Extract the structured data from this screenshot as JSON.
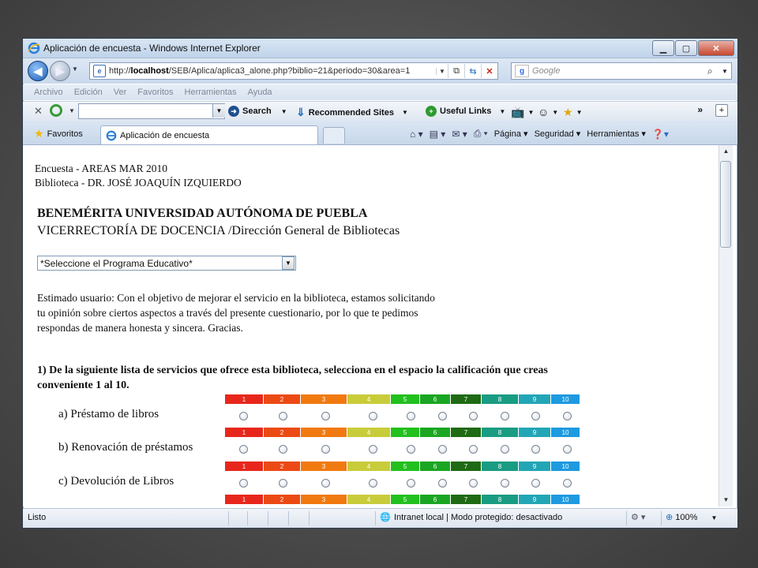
{
  "window": {
    "title": "Aplicación de encuesta - Windows Internet Explorer"
  },
  "address": {
    "url_prefix": "http://",
    "url_host": "localhost",
    "url_path": "/SEB/Aplica/aplica3_alone.php?biblio=21&periodo=30&area=1"
  },
  "search": {
    "placeholder": "Google"
  },
  "menu": [
    "Archivo",
    "Edición",
    "Ver",
    "Favoritos",
    "Herramientas",
    "Ayuda"
  ],
  "toolbar": {
    "search_label": "Search",
    "recommended_label": "Recommended Sites",
    "useful_links_label": "Useful Links"
  },
  "tabs": {
    "favorites_label": "Favoritos",
    "active_tab": "Aplicación de encuesta"
  },
  "commandbar": {
    "page": "Página",
    "security": "Seguridad",
    "tools": "Herramientas"
  },
  "page": {
    "survey_line": "Encuesta - AREAS MAR 2010",
    "library_line": "Biblioteca - DR. JOSÉ JOAQUÍN IZQUIERDO",
    "university": "BENEMÉRITA UNIVERSIDAD AUTÓNOMA DE PUEBLA",
    "department": "VICERRECTORÍA DE DOCENCIA /Dirección General de Bibliotecas",
    "program_select": "*Seleccione el Programa Educativo*",
    "intro": [
      "Estimado usuario: Con el objetivo de mejorar el servicio en la biblioteca, estamos solicitando",
      "tu opinión sobre ciertos aspectos a través del presente cuestionario, por lo que te pedimos",
      "respondas de manera honesta y sincera. Gracias."
    ],
    "question1": [
      "1) De la siguiente lista de servicios que ofrece esta biblioteca, selecciona en el espacio la calificación que creas",
      "conveniente 1 al 10."
    ],
    "scale_labels": [
      "1",
      "2",
      "3",
      "4",
      "5",
      "6",
      "7",
      "8",
      "9",
      "10"
    ],
    "scale_colors": [
      "#e8271c",
      "#ec4a14",
      "#f07a10",
      "#c8cc3a",
      "#22c01e",
      "#1aa622",
      "#1f6a14",
      "#1a9c83",
      "#22a6b6",
      "#1e9ae0"
    ],
    "items": [
      "a) Préstamo de libros",
      "b) Renovación de préstamos",
      "c) Devolución de Libros"
    ]
  },
  "status": {
    "left": "Listo",
    "zone": "Intranet local | Modo protegido: desactivado",
    "zoom": "100%"
  }
}
